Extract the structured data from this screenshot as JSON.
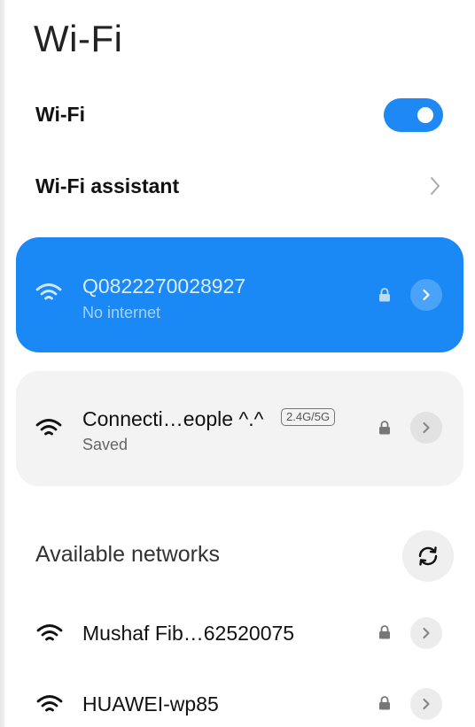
{
  "page": {
    "title": "Wi-Fi"
  },
  "wifi_toggle": {
    "label": "Wi-Fi",
    "enabled": true
  },
  "wifi_assistant": {
    "label": "Wi-Fi assistant"
  },
  "connected_network": {
    "name": "Q0822270028927",
    "status": "No internet",
    "icon": "wifi-signal-icon",
    "secured": true
  },
  "saved_network": {
    "name": "Connecti…eople ^.^",
    "badge": "2.4G/5G",
    "status": "Saved",
    "icon": "wifi-signal-icon",
    "secured": true
  },
  "available": {
    "title": "Available networks",
    "refresh_icon": "refresh-icon",
    "networks": [
      {
        "name": "Mushaf Fib…62520075",
        "secured": true
      },
      {
        "name": "HUAWEI-wp85",
        "secured": true
      }
    ]
  },
  "colors": {
    "accent": "#1b89f5",
    "card_gray": "#f3f3f3"
  }
}
